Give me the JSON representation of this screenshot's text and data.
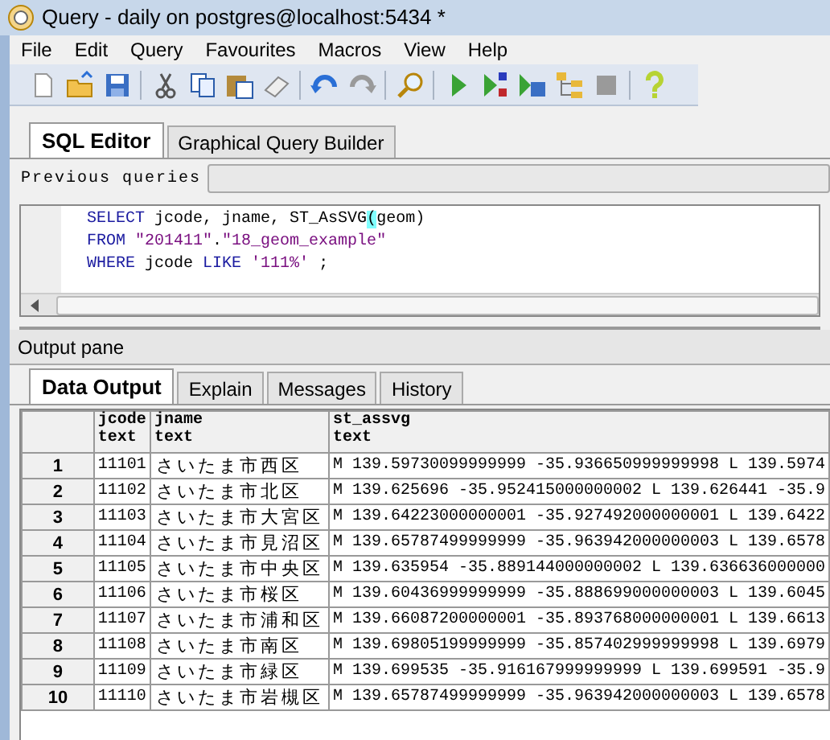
{
  "window": {
    "title": "Query - daily on postgres@localhost:5434 *"
  },
  "menu": [
    "File",
    "Edit",
    "Query",
    "Favourites",
    "Macros",
    "View",
    "Help"
  ],
  "toolbar_groups": [
    [
      {
        "kind": "new",
        "disabled": false
      },
      {
        "kind": "open",
        "disabled": false
      },
      {
        "kind": "save",
        "disabled": false
      }
    ],
    [
      {
        "kind": "cut",
        "disabled": false
      },
      {
        "kind": "copy",
        "disabled": false
      },
      {
        "kind": "paste",
        "disabled": false
      },
      {
        "kind": "clear",
        "disabled": false
      }
    ],
    [
      {
        "kind": "undo",
        "disabled": false
      },
      {
        "kind": "redo",
        "disabled": true
      }
    ],
    [
      {
        "kind": "find",
        "disabled": false
      }
    ],
    [
      {
        "kind": "run",
        "disabled": false
      },
      {
        "kind": "runscript",
        "disabled": false
      },
      {
        "kind": "runsave",
        "disabled": false
      },
      {
        "kind": "explain",
        "disabled": false
      },
      {
        "kind": "stop",
        "disabled": true
      }
    ],
    [
      {
        "kind": "help",
        "disabled": false
      }
    ]
  ],
  "editor_tabs": [
    {
      "label": "SQL Editor",
      "selected": true
    },
    {
      "label": "Graphical Query Builder",
      "selected": false
    }
  ],
  "previous_queries": {
    "label": "Previous queries"
  },
  "sql_lines": [
    [
      {
        "kind": "keyword",
        "text": "SELECT"
      },
      {
        "kind": "plain",
        "text": " jcode, jname, ST_AsSVG"
      },
      {
        "kind": "match",
        "text": "("
      },
      {
        "kind": "plain",
        "text": "geom)"
      }
    ],
    [
      {
        "kind": "keyword",
        "text": "FROM "
      },
      {
        "kind": "string",
        "text": "\"201411\""
      },
      {
        "kind": "plain",
        "text": "."
      },
      {
        "kind": "string",
        "text": "\"18_geom_example\""
      }
    ],
    [
      {
        "kind": "keyword",
        "text": "WHERE"
      },
      {
        "kind": "plain",
        "text": " jcode "
      },
      {
        "kind": "keyword",
        "text": "LIKE "
      },
      {
        "kind": "string",
        "text": "'111%'"
      },
      {
        "kind": "plain",
        "text": " ;"
      }
    ]
  ],
  "output_pane": {
    "title": "Output pane"
  },
  "output_tabs": [
    {
      "label": "Data Output",
      "selected": true
    },
    {
      "label": "Explain",
      "selected": false
    },
    {
      "label": "Messages",
      "selected": false
    },
    {
      "label": "History",
      "selected": false
    }
  ],
  "table": {
    "columns": [
      {
        "name": "jcode",
        "type": "text"
      },
      {
        "name": "jname",
        "type": "text"
      },
      {
        "name": "st_assvg",
        "type": "text"
      }
    ],
    "rows": [
      {
        "num": "1",
        "cells": [
          "11101",
          "さいたま市西区",
          "M 139.59730099999999 -35.936650999999998 L 139.5974"
        ]
      },
      {
        "num": "2",
        "cells": [
          "11102",
          "さいたま市北区",
          "M 139.625696 -35.952415000000002 L 139.626441 -35.9"
        ]
      },
      {
        "num": "3",
        "cells": [
          "11103",
          "さいたま市大宮区",
          "M 139.64223000000001 -35.927492000000001 L 139.6422"
        ]
      },
      {
        "num": "4",
        "cells": [
          "11104",
          "さいたま市見沼区",
          "M 139.65787499999999 -35.963942000000003 L 139.6578"
        ]
      },
      {
        "num": "5",
        "cells": [
          "11105",
          "さいたま市中央区",
          "M 139.635954 -35.889144000000002 L 139.636636000000"
        ]
      },
      {
        "num": "6",
        "cells": [
          "11106",
          "さいたま市桜区",
          "M 139.60436999999999 -35.888699000000003 L 139.6045"
        ]
      },
      {
        "num": "7",
        "cells": [
          "11107",
          "さいたま市浦和区",
          "M 139.66087200000001 -35.893768000000001 L 139.6613"
        ]
      },
      {
        "num": "8",
        "cells": [
          "11108",
          "さいたま市南区",
          "M 139.69805199999999 -35.857402999999998 L 139.6979"
        ]
      },
      {
        "num": "9",
        "cells": [
          "11109",
          "さいたま市緑区",
          "M 139.699535 -35.916167999999999 L 139.699591 -35.9"
        ]
      },
      {
        "num": "10",
        "cells": [
          "11110",
          "さいたま市岩槻区",
          "M 139.65787499999999 -35.963942000000003 L 139.6578"
        ]
      }
    ]
  }
}
